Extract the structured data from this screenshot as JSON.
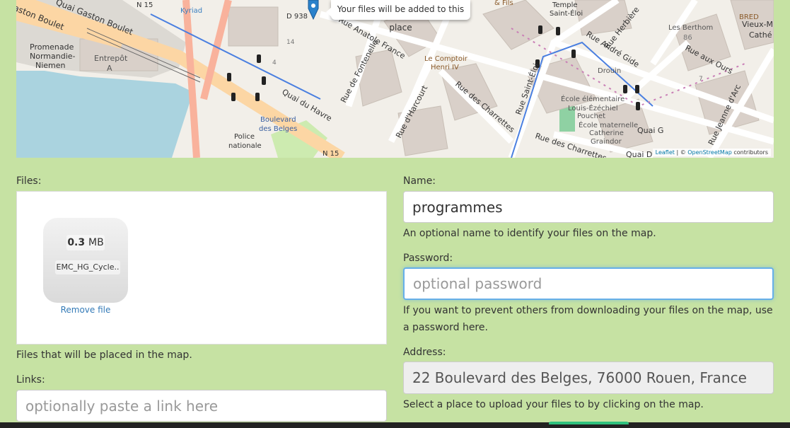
{
  "map": {
    "popup_text": "Your files will be added to this place",
    "attribution": {
      "leaflet": "Leaflet",
      "separator": " | © ",
      "osm": "OpenStreetMap",
      "suffix": " contributors"
    },
    "labels": {
      "gaston_boulet": "Quai Gaston Boulet",
      "aston_boulet": "aston Boulet",
      "n15_top": "N 15",
      "kyriad": "Kyriad",
      "d938": "D 938",
      "promenade1": "Promenade",
      "promenade2": "Normandie-",
      "promenade3": "Niemen",
      "entrepot1": "Entrepôt",
      "entrepot2": "A",
      "rue_anatole": "Rue Anatole France",
      "le_comptoir1": "Le Comptoir",
      "le_comptoir2": "Henri IV",
      "rue_fontenelle": "Rue de Fontenelle",
      "rue_harcourt": "Rue d'Harcourt",
      "rue_charrettes": "Rue des Charrettes",
      "quai_havre": "Quai du Havre",
      "boulevard_belges1": "Boulevard",
      "boulevard_belges2": "des Belges",
      "police1": "Police",
      "police2": "nationale",
      "n15_bottom": "N 15",
      "temple1": "Temple",
      "temple2": "Saint-Éloi",
      "fils": "& Fils",
      "rue_saint_eloi": "Rue Saint-Éloi",
      "rue_herbiere": "Rue Herbière",
      "rue_andre_gide": "Rue André Gide",
      "drouin": "Drouin",
      "les_berthom": "Les Berthom",
      "num86": "86",
      "bred": "BRED",
      "vieux_marche": "Vieux-M",
      "cathe": "Cathé",
      "rue_aux_ours": "Rue aux Ours",
      "rue_jeanne": "Rue Jeanne d'Arc",
      "ecole1": "École élémentaire",
      "ecole2": "Louis-Ézéchiel",
      "ecole3": "Pouchet",
      "ecole4": "École maternelle",
      "ecole5": "Catherine",
      "ecole6": "Graindor",
      "quai_g": "Quai G",
      "quai_d": "Quai D",
      "rue_charrettes2": "Rue des Charrettes",
      "num14": "14",
      "num4": "4",
      "num7": "7"
    }
  },
  "form": {
    "files": {
      "label": "Files:",
      "file_size_value": "0.3",
      "file_size_unit": "MB",
      "file_name": "EMC_HG_Cycle..",
      "remove_label": "Remove file",
      "help": "Files that will be placed in the map."
    },
    "links": {
      "label": "Links:",
      "placeholder": "optionally paste a link here",
      "value": ""
    },
    "name": {
      "label": "Name:",
      "value": "programmes",
      "help": "An optional name to identify your files on the map."
    },
    "password": {
      "label": "Password:",
      "placeholder": "optional password",
      "value": "",
      "help": "If you want to prevent others from downloading your files on the map, use a password here."
    },
    "address": {
      "label": "Address:",
      "value": "22 Boulevard des Belges, 76000 Rouen, France",
      "help": "Select a place to upload your files to by clicking on the map."
    }
  },
  "colors": {
    "page_background": "#c6e2a3",
    "link": "#337ab7",
    "focus": "#66afe9",
    "submit_accent": "#2ec27e"
  }
}
